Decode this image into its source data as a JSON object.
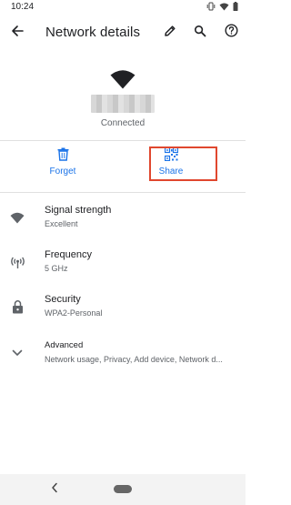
{
  "status_bar": {
    "time": "10:24"
  },
  "toolbar": {
    "title": "Network details"
  },
  "network": {
    "status": "Connected"
  },
  "actions": {
    "forget_label": "Forget",
    "share_label": "Share"
  },
  "details": [
    {
      "icon": "wifi-icon",
      "title": "Signal strength",
      "value": "Excellent"
    },
    {
      "icon": "antenna-icon",
      "title": "Frequency",
      "value": "5 GHz"
    },
    {
      "icon": "lock-icon",
      "title": "Security",
      "value": "WPA2-Personal"
    }
  ],
  "advanced": {
    "title": "Advanced",
    "summary": "Network usage, Privacy, Add device, Network d..."
  },
  "colors": {
    "accent": "#1a73e8",
    "highlight": "#e0472e",
    "icon": "#5f6368"
  }
}
